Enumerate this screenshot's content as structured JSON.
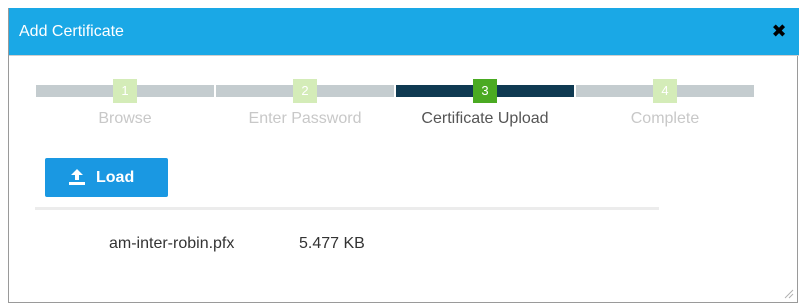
{
  "dialog": {
    "title": "Add Certificate",
    "close_glyph": "✖"
  },
  "wizard": {
    "steps": [
      {
        "number": "1",
        "label": "Browse",
        "active": false
      },
      {
        "number": "2",
        "label": "Enter Password",
        "active": false
      },
      {
        "number": "3",
        "label": "Certificate Upload",
        "active": true
      },
      {
        "number": "4",
        "label": "Complete",
        "active": false
      }
    ]
  },
  "toolbar": {
    "load_label": "Load",
    "load_icon": "upload-icon"
  },
  "file": {
    "name": "am-inter-robin.pfx",
    "size": "5.477 KB"
  },
  "colors": {
    "title_bar": "#1aa8e6",
    "active_step_bar": "#0f3a52",
    "active_step_badge": "#4aaa22",
    "inactive_step_bar": "#c4cccf",
    "inactive_step_badge": "#d4ecb8",
    "button": "#1a98e2"
  }
}
